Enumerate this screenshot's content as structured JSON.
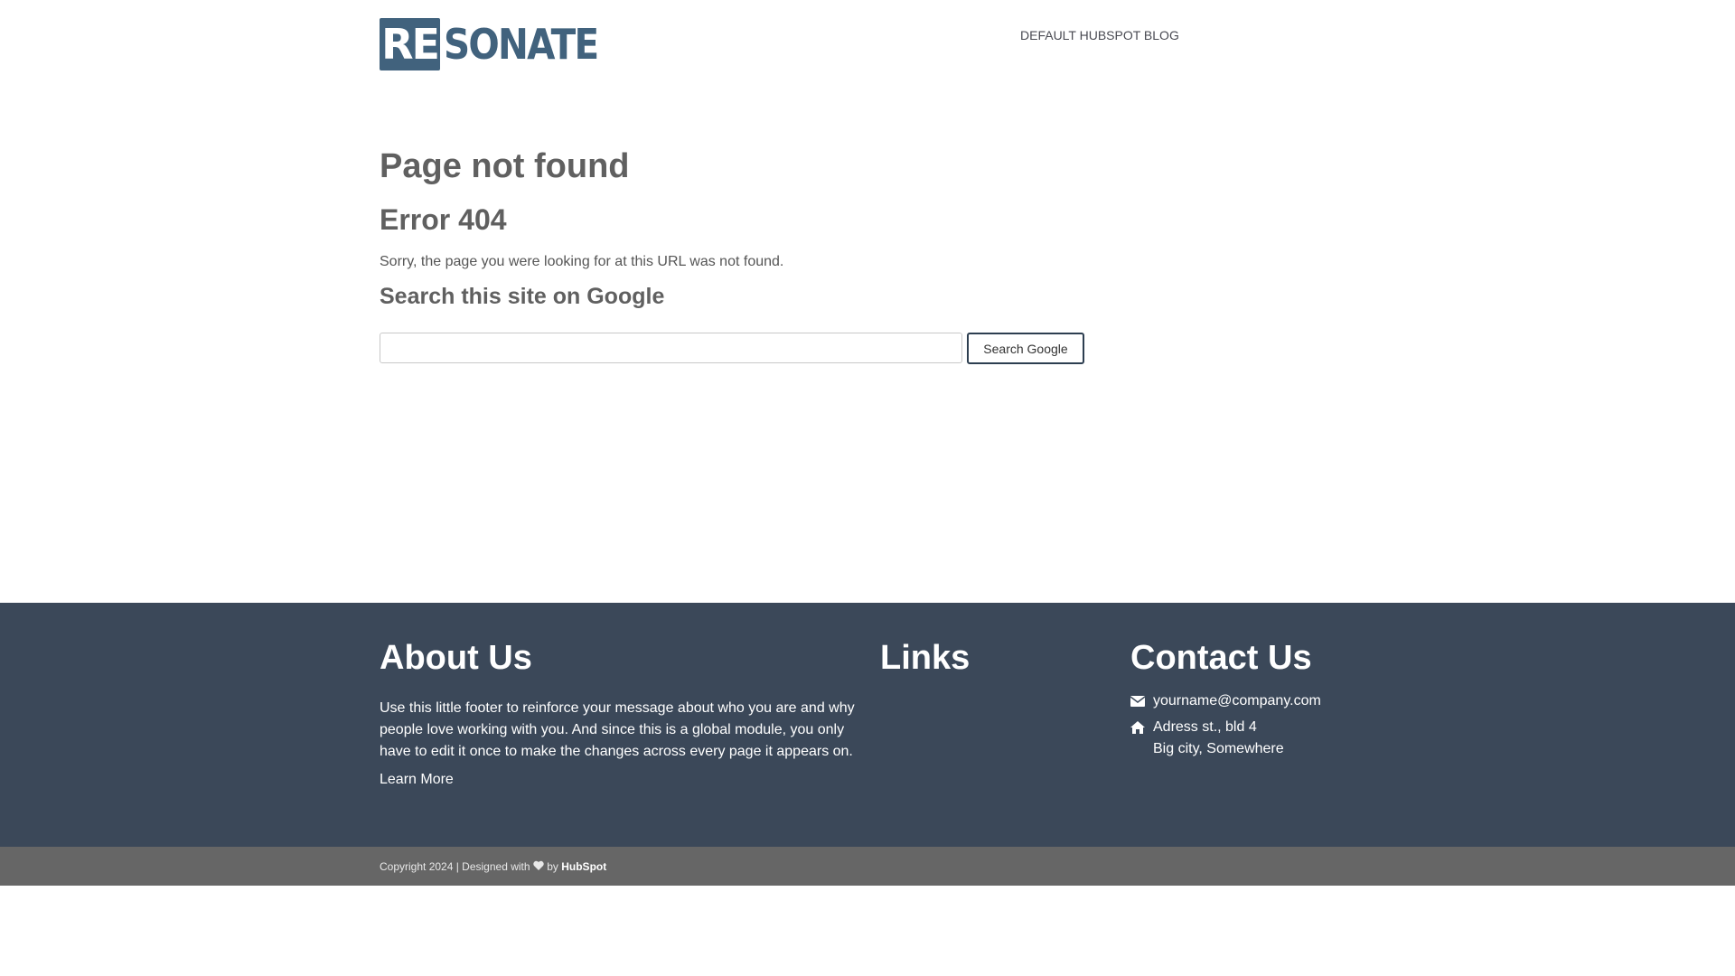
{
  "header": {
    "logo_box": "RE",
    "logo_rest": "SONATE",
    "nav_link": "DEFAULT HUBSPOT BLOG"
  },
  "main": {
    "title": "Page not found",
    "error": "Error 404",
    "message": "Sorry, the page you were looking for at this URL was not found.",
    "search_heading": "Search this site on Google",
    "search_placeholder": "",
    "search_button": "Search Google"
  },
  "footer": {
    "about_heading": "About Us",
    "about_text": "Use this little footer to reinforce your message about who you are and why people love working with you. And since this is a global module, you only have to edit it once to make the changes across every page it appears on.",
    "learn_more": "Learn More",
    "links_heading": "Links",
    "contact_heading": "Contact Us",
    "email": "yourname@company.com",
    "address_line1": "Adress st., bld 4",
    "address_line2": "Big city, Somewhere"
  },
  "bottom": {
    "copyright": "Copyright 2024 | Designed with ",
    "by": " by ",
    "hubspot": "HubSpot"
  },
  "icons": {
    "email": "envelope-icon",
    "address": "home-icon",
    "heart": "heart-icon"
  },
  "colors": {
    "brand": "#41627d",
    "footer_bg": "#3b4859",
    "bottom_bg": "#666666"
  }
}
